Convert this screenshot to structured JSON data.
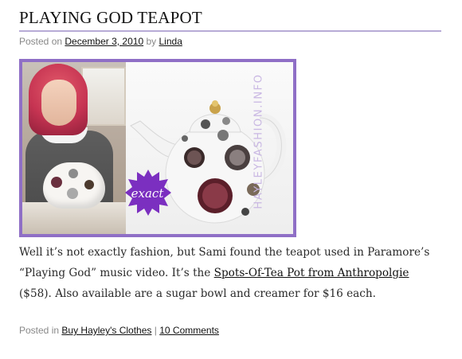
{
  "post": {
    "title": "PLAYING GOD TEAPOT",
    "meta": {
      "posted_on_label": "Posted on",
      "date": "December 3, 2010",
      "by_label": "by",
      "author": "Linda"
    },
    "image": {
      "watermark": "HAYLEYFASHION.INFO",
      "badge_text": "exact",
      "colors": {
        "frame": "#8f6fc6",
        "badge": "#7b2fc0"
      }
    },
    "body": {
      "text_1": "Well it’s not exactly fashion, but Sami found the teapot used in Paramore’s “Playing God” music video. It’s the ",
      "link": "Spots-Of-Tea Pot from Anthropolgie",
      "text_2": " ($58). Also available are a sugar bowl and creamer for $16 each."
    },
    "footer": {
      "posted_in_label": "Posted in",
      "category": "Buy Hayley's Clothes",
      "separator": "|",
      "comments": "10 Comments"
    }
  }
}
